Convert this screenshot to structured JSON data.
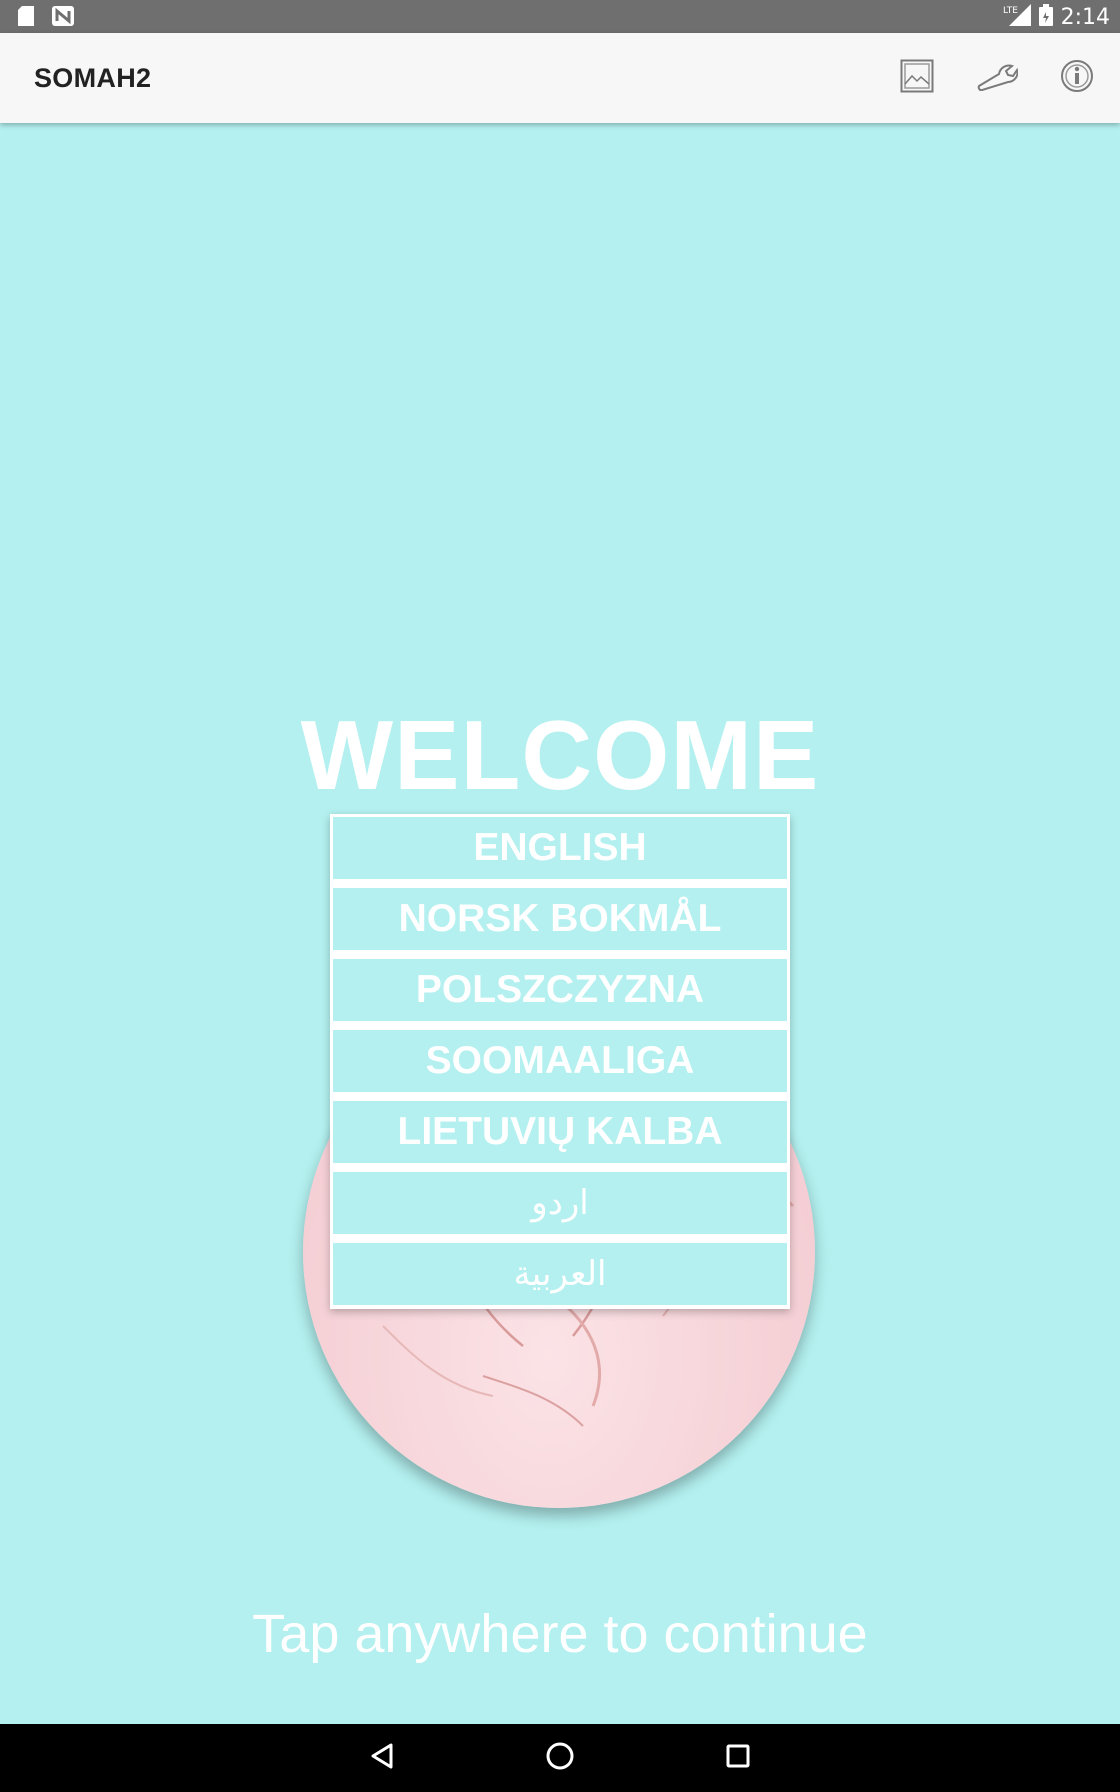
{
  "status_bar": {
    "time": "2:14",
    "network": "LTE",
    "icons": [
      "sd-card-icon",
      "n-notification-icon",
      "lte-signal-icon",
      "battery-icon"
    ]
  },
  "app_bar": {
    "title": "SOMAH2",
    "actions": [
      "image-icon",
      "wrench-icon",
      "info-icon"
    ]
  },
  "main": {
    "welcome": "WELCOME",
    "languages": [
      {
        "label": "ENGLISH"
      },
      {
        "label": "NORSK BOKMÅL"
      },
      {
        "label": "POLSZCZYZNA"
      },
      {
        "label": "SOOMAALIGA"
      },
      {
        "label": "LIETUVIŲ KALBA"
      },
      {
        "label": "اردو"
      },
      {
        "label": "العربية"
      }
    ],
    "tap_hint": "Tap anywhere to continue"
  },
  "colors": {
    "background": "#b3f0ef",
    "app_bar": "#f7f7f7",
    "status_bar": "#6f6f6f",
    "nav_bar": "#000000",
    "text_light": "#ffffff"
  },
  "nav_bar": {
    "buttons": [
      "back-icon",
      "home-icon",
      "recents-icon"
    ]
  }
}
